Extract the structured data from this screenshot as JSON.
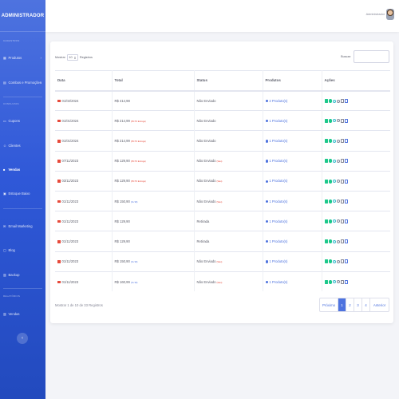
{
  "sidebar": {
    "brand": "ADMINISTRADOR",
    "sections": {
      "cadastros": "CADASTROS",
      "consultas": "CONSULTAS",
      "relatorios": "RELATÓRIOS"
    },
    "items": {
      "produtos": "Produtos",
      "combos": "Combos e Promoções",
      "cupons": "Cupons",
      "clientes": "Clientes",
      "vendas": "Vendas",
      "estoque": "Estoque Baixo",
      "email": "Email Marketing",
      "blog": "Blog",
      "backup": "Backup",
      "rel_vendas": "Vendas"
    },
    "toggle": "‹"
  },
  "topbar": {
    "user": "Administrador"
  },
  "table_controls": {
    "show_label": "Mostrar",
    "page_size": "10",
    "records_label": "Registros",
    "search_label": "Buscar:"
  },
  "columns": [
    "Data",
    "Total",
    "Status",
    "Produtos",
    "Ações"
  ],
  "rows": [
    {
      "date": "01/02/2024",
      "total": "R$ 414,98",
      "note": "",
      "note_color": "",
      "status": "Não Enviado",
      "status_note": "",
      "products": "2 Produto(s)"
    },
    {
      "date": "01/01/2024",
      "total": "R$ 214,99",
      "note": "(PGTO Entrega)",
      "note_color": "red",
      "status": "Não Enviado",
      "status_note": "",
      "products": "1 Produto(s)"
    },
    {
      "date": "01/01/2024",
      "total": "R$ 214,99",
      "note": "(PGTO Entrega)",
      "note_color": "red",
      "status": "Não Enviado",
      "status_note": "",
      "products": "1 Produto(s)"
    },
    {
      "date": "07/11/2023",
      "total": "R$ 129,90",
      "note": "(PGTO Entrega)",
      "note_color": "red",
      "status": "Não Enviado",
      "status_note": "(Saiu)",
      "products": "1 Produto(s)"
    },
    {
      "date": "03/11/2023",
      "total": "R$ 129,90",
      "note": "(PGTO Entrega)",
      "note_color": "red",
      "status": "Não Enviado",
      "status_note": "(Saiu)",
      "products": "1 Produto(s)"
    },
    {
      "date": "01/11/2023",
      "total": "R$ 150,90",
      "note": "(CL 99)",
      "note_color": "blue",
      "status": "Não Enviado",
      "status_note": "(Saiu)",
      "products": "1 Produto(s)"
    },
    {
      "date": "01/11/2023",
      "total": "R$ 129,90",
      "note": "",
      "note_color": "",
      "status": "Retirada",
      "status_note": "",
      "products": "1 Produto(s)"
    },
    {
      "date": "01/11/2023",
      "total": "R$ 129,90",
      "note": "",
      "note_color": "",
      "status": "Retirada",
      "status_note": "",
      "products": "1 Produto(s)"
    },
    {
      "date": "01/11/2023",
      "total": "R$ 150,90",
      "note": "(CL 99)",
      "note_color": "blue",
      "status": "Não Enviado",
      "status_note": "(Saiu)",
      "products": "1 Produto(s)"
    },
    {
      "date": "01/11/2023",
      "total": "R$ 160,99",
      "note": "(CL 99)",
      "note_color": "blue",
      "status": "Não Enviado",
      "status_note": "(Saiu)",
      "products": "1 Produto(s)"
    }
  ],
  "footer": {
    "info": "Mostrar 1 de 10 de 33 Registros",
    "pagination": {
      "prev": "Próximo",
      "pages": [
        "1",
        "2",
        "3",
        "4"
      ],
      "next": "Anterior",
      "active": "1"
    }
  },
  "colors": {
    "sidebar": "#4e73df",
    "accent": "#4e73df",
    "danger": "#e74a3b",
    "success": "#1cc88a"
  },
  "icons": {
    "actions": [
      "edit-icon",
      "confirm-icon",
      "view-icon",
      "info-icon",
      "user-icon",
      "document-icon"
    ]
  }
}
